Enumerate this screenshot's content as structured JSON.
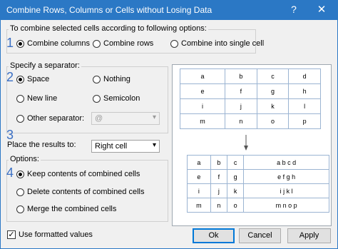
{
  "window": {
    "title": "Combine Rows, Columns or Cells without Losing Data",
    "help": "?",
    "close": "✕"
  },
  "combine": {
    "legend": "To combine selected cells according to following options:",
    "step": "1",
    "options": [
      "Combine columns",
      "Combine rows",
      "Combine into single cell"
    ],
    "selected": 0
  },
  "separator": {
    "legend": "Specify a separator:",
    "step": "2",
    "space": "Space",
    "nothing": "Nothing",
    "new_line": "New line",
    "semicolon": "Semicolon",
    "other": "Other separator:",
    "other_value": "@",
    "selected": "Space"
  },
  "place": {
    "step": "3",
    "label": "Place the results to:",
    "value": "Right cell"
  },
  "options": {
    "legend": "Options:",
    "step": "4",
    "items": [
      "Keep contents of combined cells",
      "Delete contents of combined cells",
      "Merge the combined cells"
    ],
    "selected": 0
  },
  "preview": {
    "before": [
      [
        "a",
        "b",
        "c",
        "d"
      ],
      [
        "e",
        "f",
        "g",
        "h"
      ],
      [
        "i",
        "j",
        "k",
        "l"
      ],
      [
        "m",
        "n",
        "o",
        "p"
      ]
    ],
    "after": [
      [
        "a",
        "b",
        "c",
        "a b c d"
      ],
      [
        "e",
        "f",
        "g",
        "e f g h"
      ],
      [
        "i",
        "j",
        "k",
        "i j k l"
      ],
      [
        "m",
        "n",
        "o",
        "m n o p"
      ]
    ]
  },
  "footer": {
    "use_formatted": "Use formatted values",
    "checked": true,
    "ok": "Ok",
    "cancel": "Cancel",
    "apply": "Apply"
  }
}
